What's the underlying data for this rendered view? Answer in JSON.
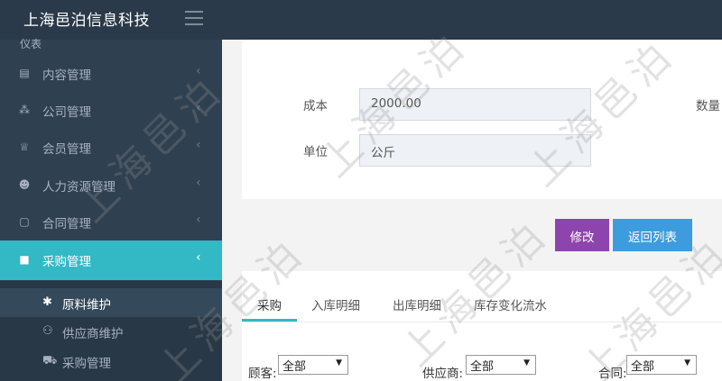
{
  "header": {
    "brand": "上海邑泊信息科技"
  },
  "sidebar": {
    "top_fragment": "仪表",
    "items": [
      {
        "label": "内容管理",
        "icon": "newspaper-icon"
      },
      {
        "label": "公司管理",
        "icon": "sitemap-icon"
      },
      {
        "label": "会员管理",
        "icon": "trophy-icon"
      },
      {
        "label": "人力资源管理",
        "icon": "users-icon"
      },
      {
        "label": "合同管理",
        "icon": "file-icon"
      },
      {
        "label": "采购管理",
        "icon": "cart-box-icon"
      }
    ],
    "subitems": [
      {
        "label": "原料维护",
        "icon": "asterisk-icon"
      },
      {
        "label": "供应商维护",
        "icon": "binoculars-icon"
      },
      {
        "label": "采购管理",
        "icon": "cart-icon"
      }
    ]
  },
  "form": {
    "cost_label": "成本",
    "cost_value": "2000.00",
    "quantity_label": "数量",
    "unit_label": "单位",
    "unit_value": "公斤"
  },
  "actions": {
    "edit_label": "修改",
    "back_label": "返回列表"
  },
  "tabs": [
    {
      "label": "采购"
    },
    {
      "label": "入库明细"
    },
    {
      "label": "出库明细"
    },
    {
      "label": "库存变化流水"
    }
  ],
  "filters": {
    "customer_label": "顾客:",
    "customer_value": "全部",
    "supplier_label": "供应商:",
    "supplier_value": "全部",
    "contract_label": "合同:",
    "contract_value": "全部"
  },
  "watermark": "上海邑泊"
}
